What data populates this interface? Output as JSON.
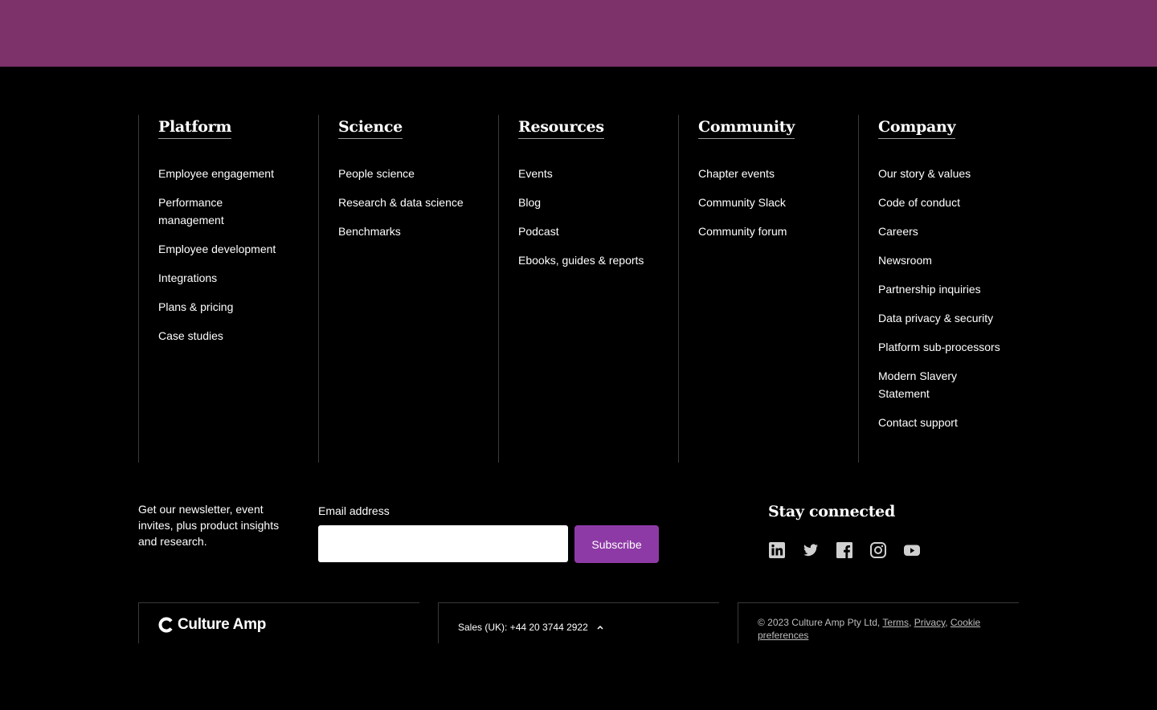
{
  "columns": [
    {
      "title": "Platform",
      "links": [
        "Employee engagement",
        "Performance management",
        "Employee development",
        "Integrations",
        "Plans & pricing",
        "Case studies"
      ]
    },
    {
      "title": "Science",
      "links": [
        "People science",
        "Research & data science",
        "Benchmarks"
      ]
    },
    {
      "title": "Resources",
      "links": [
        "Events",
        "Blog",
        "Podcast",
        "Ebooks, guides & reports"
      ]
    },
    {
      "title": "Community",
      "links": [
        "Chapter events",
        "Community Slack",
        "Community forum"
      ]
    },
    {
      "title": "Company",
      "links": [
        "Our story & values",
        "Code of conduct",
        "Careers",
        "Newsroom",
        "Partnership inquiries",
        "Data privacy & security",
        "Platform sub-processors",
        "Modern Slavery Statement",
        "Contact support"
      ]
    }
  ],
  "newsletter": {
    "text": "Get our newsletter, event invites, plus product insights and research.",
    "email_label": "Email address",
    "email_value": "",
    "email_placeholder": "",
    "subscribe_label": "Subscribe"
  },
  "social": {
    "title": "Stay connected",
    "icons": [
      "linkedin-icon",
      "twitter-icon",
      "facebook-icon",
      "instagram-icon",
      "youtube-icon"
    ]
  },
  "bottom": {
    "brand": "Culture Amp",
    "sales": "Sales (UK): +44 20 3744 2922",
    "copyright": "© 2023 Culture Amp Pty Ltd,",
    "terms": "Terms",
    "privacy": "Privacy",
    "cookie": "Cookie preferences"
  },
  "colors": {
    "band": "#7e326a",
    "accent": "#8e3aa6",
    "background": "#000000"
  }
}
